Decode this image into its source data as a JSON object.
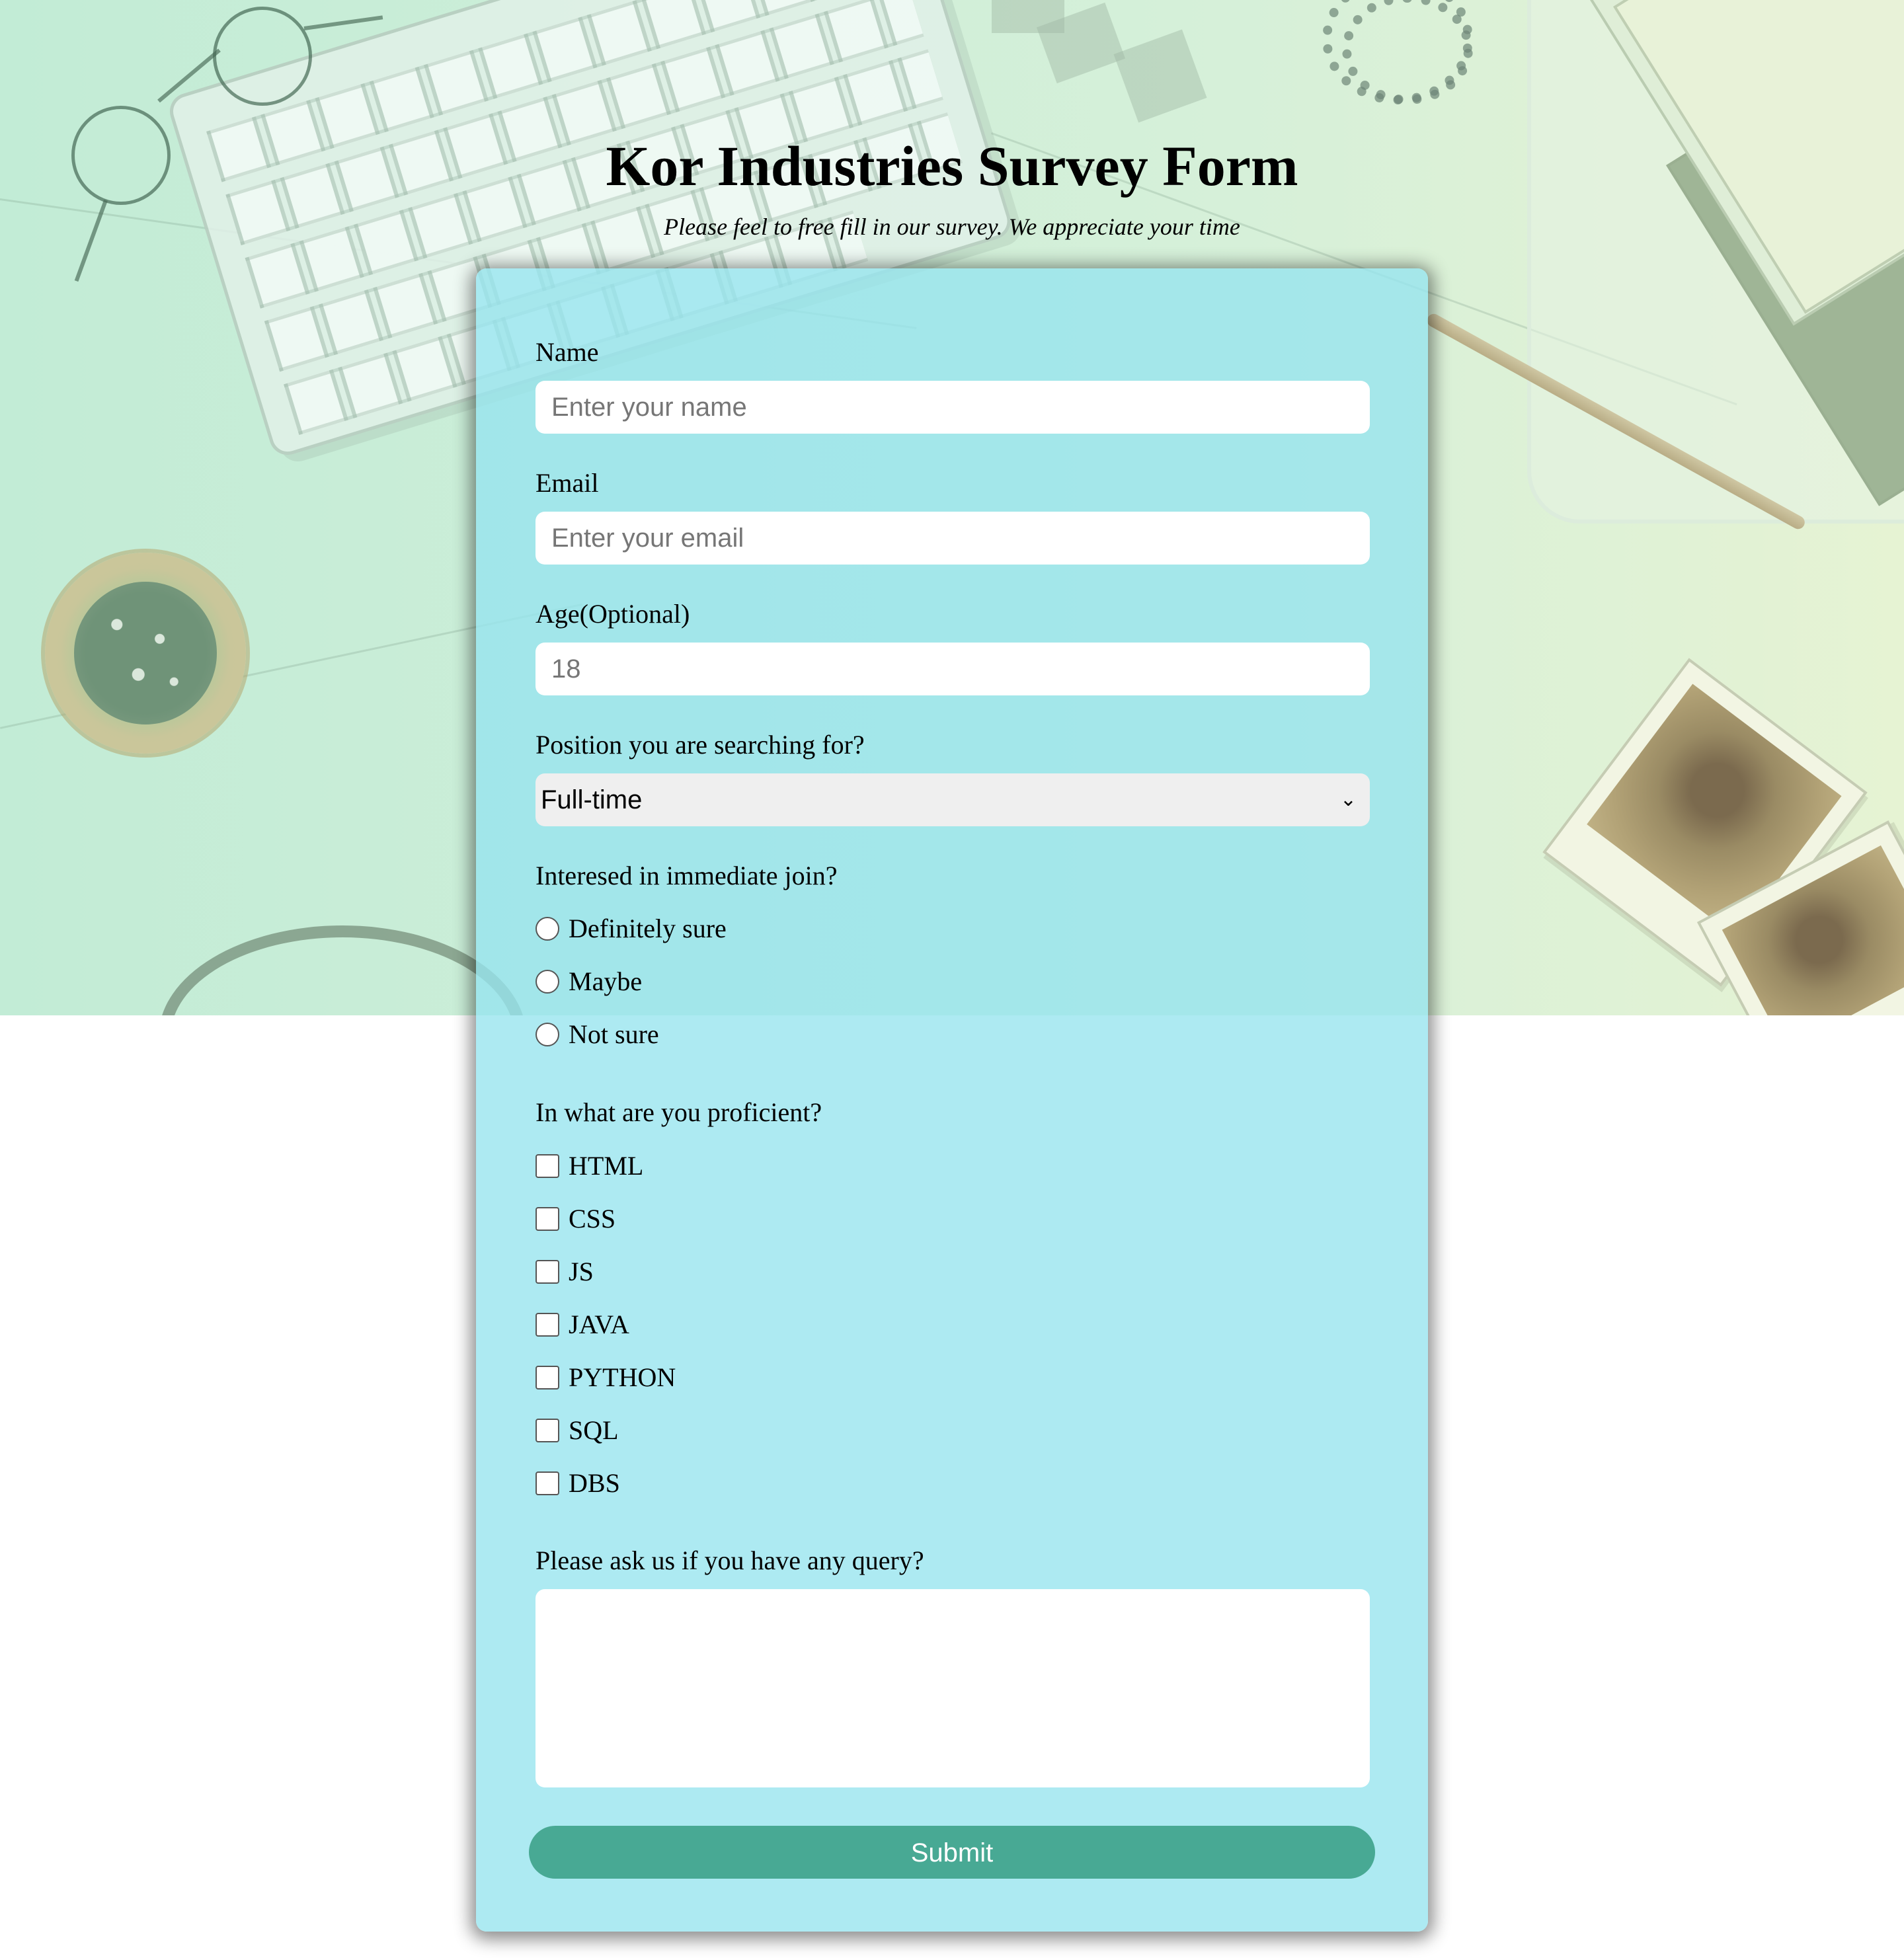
{
  "colors": {
    "card_bg": "#a7e9f0",
    "submit_bg": "#48a994",
    "submit_text": "#ffffff",
    "select_bg": "#efefef"
  },
  "header": {
    "title": "Kor Industries Survey Form",
    "subtitle": "Please feel to free fill in our survey. We appreciate your time"
  },
  "form": {
    "name": {
      "label": "Name",
      "placeholder": "Enter your name"
    },
    "email": {
      "label": "Email",
      "placeholder": "Enter your email"
    },
    "age": {
      "label": "Age(Optional)",
      "placeholder": "18"
    },
    "position": {
      "label": "Position you are searching for?",
      "selected": "Full-time"
    },
    "join": {
      "label": "Interesed in immediate join?",
      "options": [
        "Definitely sure",
        "Maybe",
        "Not sure"
      ]
    },
    "skills": {
      "label": "In what are you proficient?",
      "options": [
        "HTML",
        "CSS",
        "JS",
        "JAVA",
        "PYTHON",
        "SQL",
        "DBS"
      ]
    },
    "query": {
      "label": "Please ask us if you have any query?",
      "value": ""
    },
    "submit_label": "Submit"
  }
}
